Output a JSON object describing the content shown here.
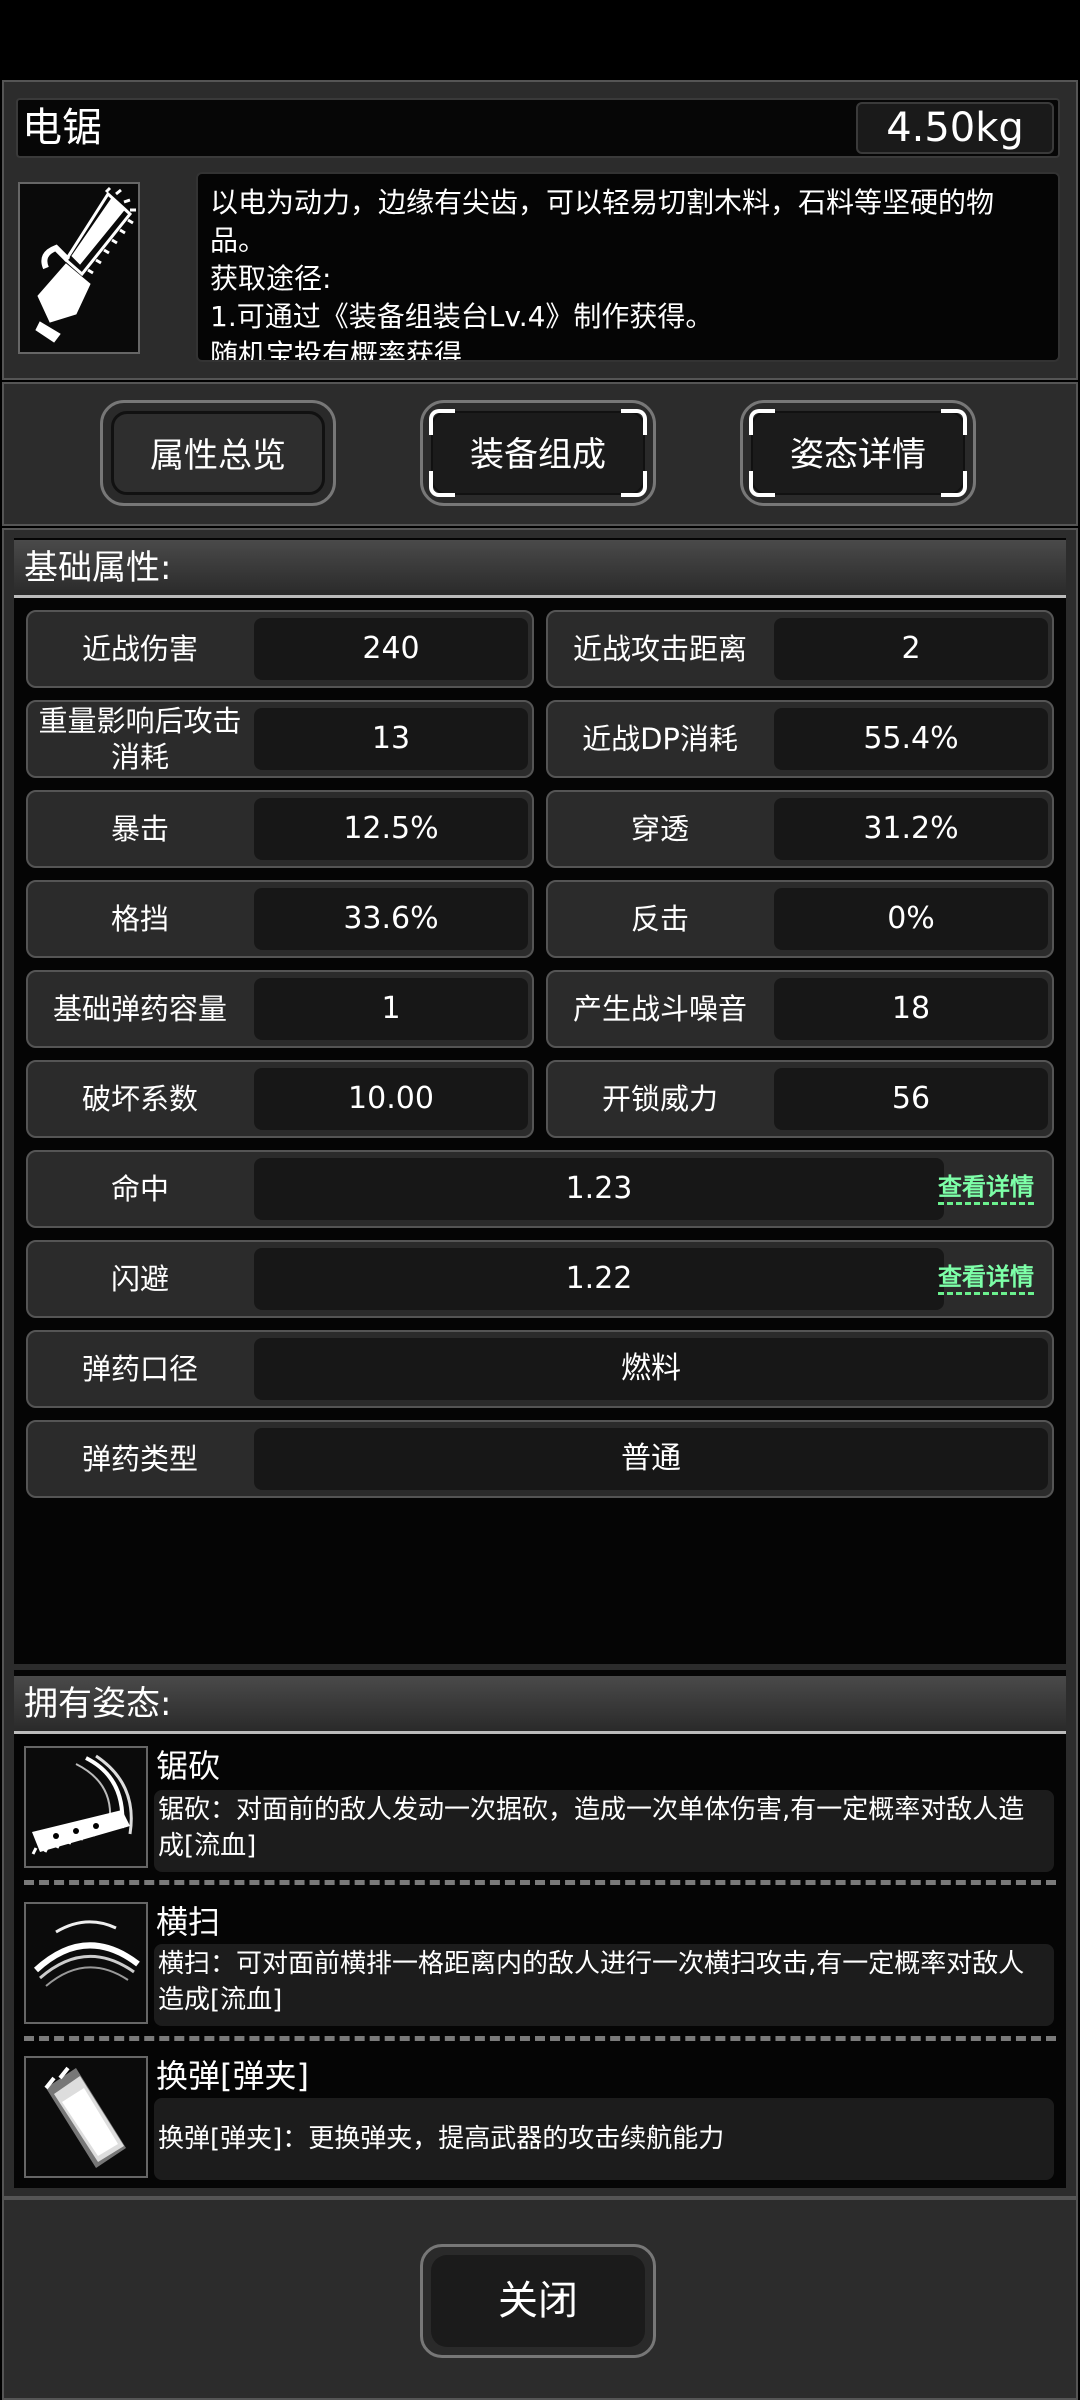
{
  "item": {
    "name": "电锯",
    "weight": "4.50kg",
    "description_lines": [
      "以电为动力，边缘有尖齿，可以轻易切割木料，石料等坚硬的物品。",
      "获取途径:",
      "1.可通过《装备组装台Lv.4》制作获得。",
      "随机宝投有概率获得"
    ]
  },
  "tabs": [
    {
      "label": "属性总览"
    },
    {
      "label": "装备组成"
    },
    {
      "label": "姿态详情"
    }
  ],
  "basic": {
    "title": "基础属性:",
    "pairs": [
      {
        "l1": "近战伤害",
        "v1": "240",
        "l2": "近战攻击距离",
        "v2": "2"
      },
      {
        "l1": "重量影响后攻击消耗",
        "v1": "13",
        "l2": "近战DP消耗",
        "v2": "55.4%"
      },
      {
        "l1": "暴击",
        "v1": "12.5%",
        "l2": "穿透",
        "v2": "31.2%"
      },
      {
        "l1": "格挡",
        "v1": "33.6%",
        "l2": "反击",
        "v2": "0%"
      },
      {
        "l1": "基础弹药容量",
        "v1": "1",
        "l2": "产生战斗噪音",
        "v2": "18"
      },
      {
        "l1": "破坏系数",
        "v1": "10.00",
        "l2": "开锁威力",
        "v2": "56"
      }
    ],
    "hit": {
      "label": "命中",
      "value": "1.23",
      "link": "查看详情"
    },
    "dodge": {
      "label": "闪避",
      "value": "1.22",
      "link": "查看详情"
    },
    "caliber": {
      "label": "弹药口径",
      "value": "燃料"
    },
    "ammo_type": {
      "label": "弹药类型",
      "value": "普通"
    }
  },
  "postures": {
    "title": "拥有姿态:",
    "items": [
      {
        "name": "锯砍",
        "desc": "锯砍：对面前的敌人发动一次据砍，造成一次单体伤害,有一定概率对敌人造成[流血]",
        "icon": "chainsaw-slash-icon"
      },
      {
        "name": "横扫",
        "desc": "横扫：可对面前横排一格距离内的敌人进行一次横扫攻击,有一定概率对敌人造成[流血]",
        "icon": "sweep-arc-icon"
      },
      {
        "name": "换弹[弹夹]",
        "desc": "换弹[弹夹]：更换弹夹，提高武器的攻击续航能力",
        "icon": "magazine-reload-icon"
      }
    ]
  },
  "close_label": "关闭"
}
